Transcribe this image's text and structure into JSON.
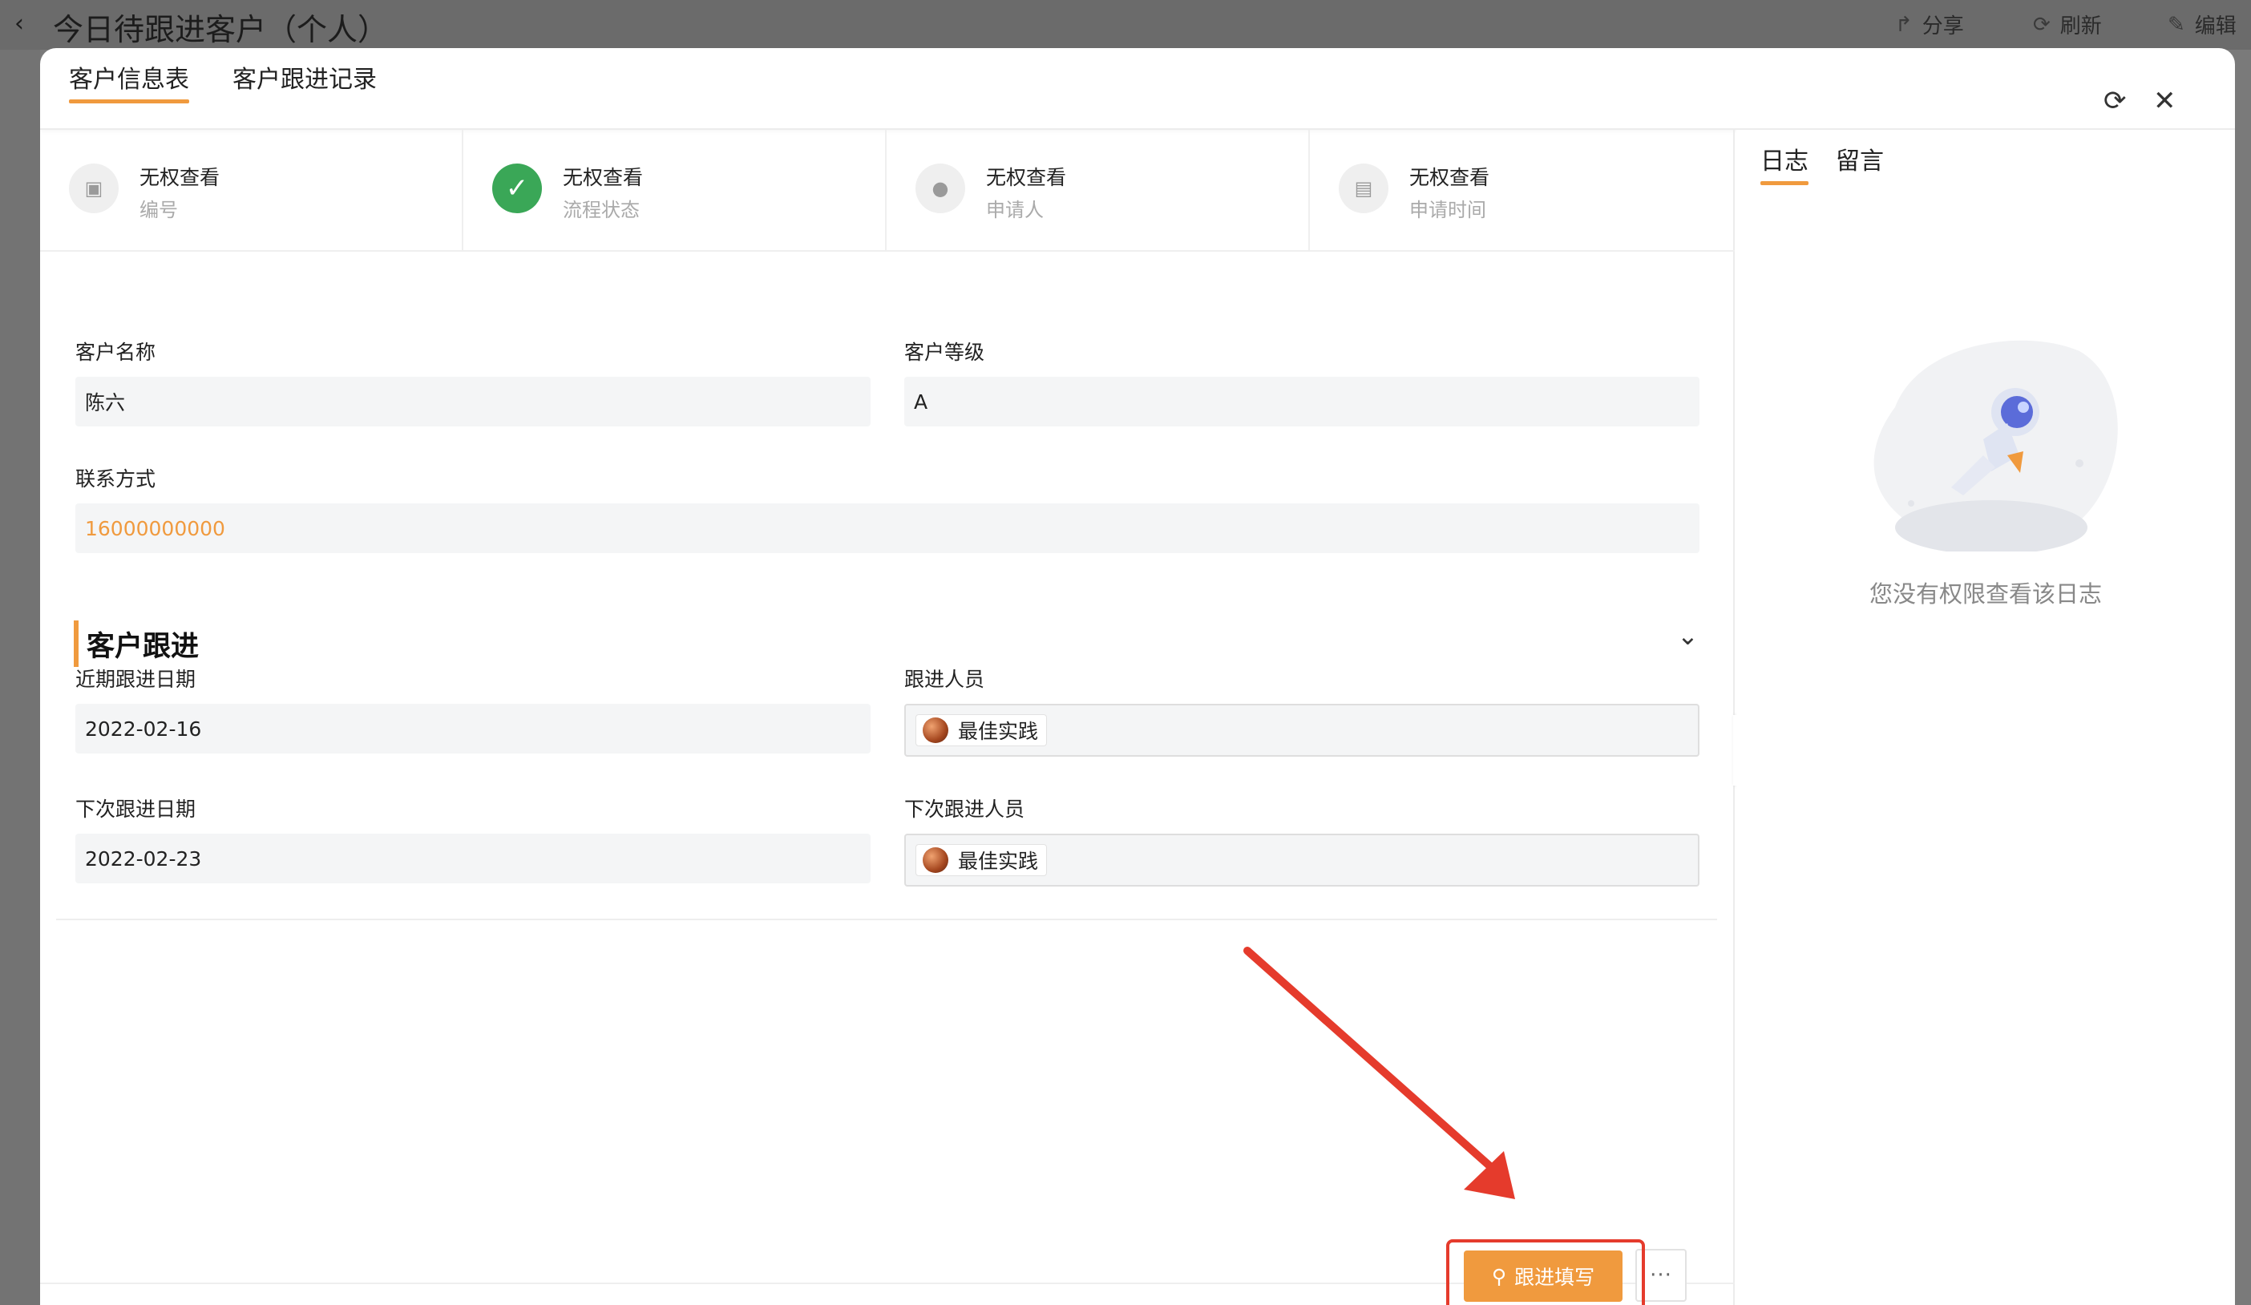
{
  "background": {
    "title": "今日待跟进客户（个人）",
    "actions": [
      {
        "label": "分享",
        "icon": "share-icon"
      },
      {
        "label": "刷新",
        "icon": "refresh-icon"
      },
      {
        "label": "编辑",
        "icon": "edit-icon"
      }
    ]
  },
  "tabs": [
    {
      "label": "客户信息表",
      "active": true
    },
    {
      "label": "客户跟进记录",
      "active": false
    }
  ],
  "status_cells": [
    {
      "main": "无权查看",
      "sub": "编号",
      "icon": "number-icon"
    },
    {
      "main": "无权查看",
      "sub": "流程状态",
      "icon": "check-icon"
    },
    {
      "main": "无权查看",
      "sub": "申请人",
      "icon": "person-icon"
    },
    {
      "main": "无权查看",
      "sub": "申请时间",
      "icon": "calendar-icon"
    }
  ],
  "form": {
    "customer_name": {
      "label": "客户名称",
      "value": "陈六"
    },
    "customer_level": {
      "label": "客户等级",
      "value": "A"
    },
    "contact": {
      "label": "联系方式",
      "value": "16000000000"
    }
  },
  "section": {
    "title": "客户跟进",
    "recent_date": {
      "label": "近期跟进日期",
      "value": "2022-02-16"
    },
    "follower": {
      "label": "跟进人员",
      "value": "最佳实践"
    },
    "next_date": {
      "label": "下次跟进日期",
      "value": "2022-02-23"
    },
    "next_follower": {
      "label": "下次跟进人员",
      "value": "最佳实践"
    }
  },
  "buttons": {
    "follow_label": "跟进填写",
    "more_label": "···"
  },
  "right_pane": {
    "tabs": [
      {
        "label": "日志",
        "active": true
      },
      {
        "label": "留言",
        "active": false
      }
    ],
    "empty_text": "您没有权限查看该日志"
  },
  "colors": {
    "accent": "#f09a3e",
    "highlight": "#e53b2c",
    "success": "#3aa757"
  }
}
